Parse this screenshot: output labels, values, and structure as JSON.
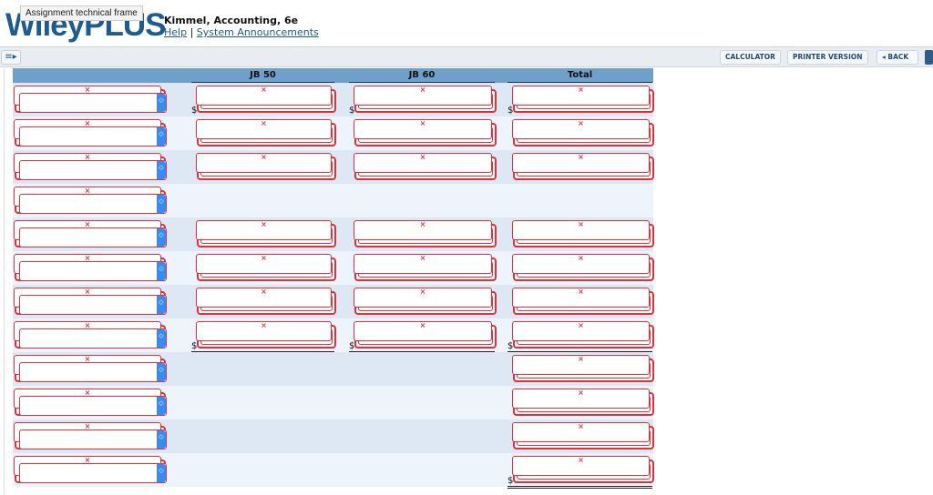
{
  "header": {
    "logo": "WileyPLUS",
    "tooltip": "Assignment technical frame",
    "course": "Kimmel, Accounting, 6e",
    "help": "Help",
    "separator": "|",
    "announcements": "System Announcements"
  },
  "toolbar": {
    "calculator": "CALCULATOR",
    "printer": "PRINTER VERSION",
    "back": "BACK",
    "back_icon": "◂",
    "menu_icon": "≡▸"
  },
  "table": {
    "columns": [
      "JB 50",
      "JB 60",
      "Total"
    ],
    "currency": "$",
    "rows": [
      {
        "select": "",
        "cells": [
          "",
          "",
          ""
        ],
        "dollar": true,
        "underline": "none"
      },
      {
        "select": "",
        "cells": [
          "",
          "",
          ""
        ],
        "dollar": false,
        "underline": "light"
      },
      {
        "select": "",
        "cells": [
          "",
          "",
          ""
        ],
        "dollar": false,
        "underline": "single"
      },
      {
        "select": "",
        "cells": null,
        "dollar": false,
        "underline": "none"
      },
      {
        "select": "",
        "cells": [
          "",
          "",
          ""
        ],
        "dollar": false,
        "underline": "none"
      },
      {
        "select": "",
        "cells": [
          "",
          "",
          ""
        ],
        "dollar": false,
        "underline": "single"
      },
      {
        "select": "",
        "cells": [
          "",
          "",
          ""
        ],
        "dollar": false,
        "underline": "single"
      },
      {
        "select": "",
        "cells": [
          "",
          "",
          ""
        ],
        "dollar": true,
        "underline": "double"
      },
      {
        "select": "",
        "cells": [
          null,
          null,
          ""
        ],
        "dollar": false,
        "underline": "single"
      },
      {
        "select": "",
        "cells": [
          null,
          null,
          ""
        ],
        "dollar": false,
        "underline": "single"
      },
      {
        "select": "",
        "cells": [
          null,
          null,
          ""
        ],
        "dollar": false,
        "underline": "single"
      },
      {
        "select": "",
        "cells": [
          null,
          null,
          ""
        ],
        "dollar": true,
        "underline": "double"
      }
    ]
  }
}
